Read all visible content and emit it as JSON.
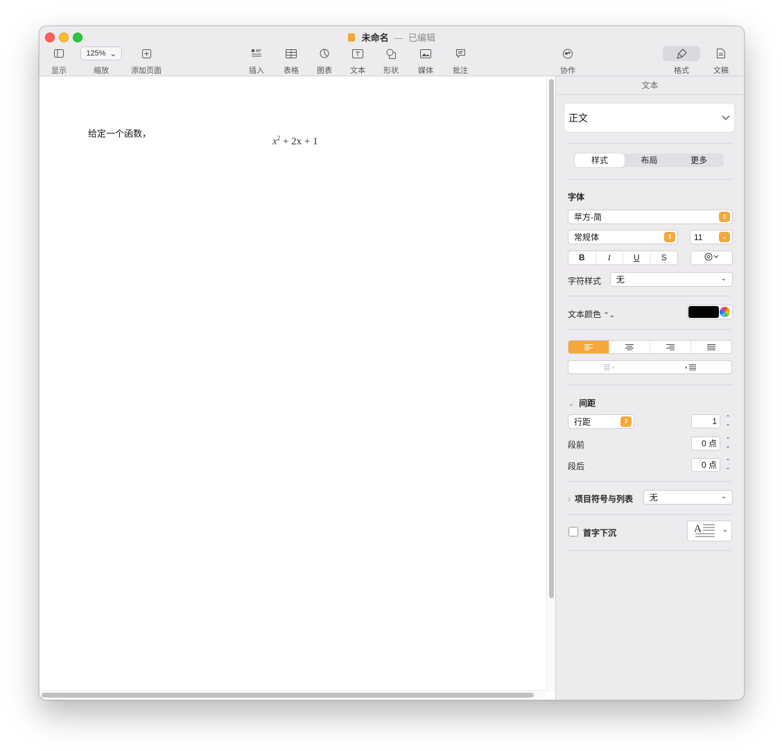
{
  "window": {
    "doc_name": "未命名",
    "separator": "—",
    "status": "已编辑"
  },
  "toolbar": {
    "view_label": "显示",
    "zoom_value": "125%",
    "zoom_label": "缩放",
    "add_page_label": "添加页面",
    "insert_label": "插入",
    "table_label": "表格",
    "chart_label": "图表",
    "text_label": "文本",
    "shape_label": "形状",
    "media_label": "媒体",
    "comment_label": "批注",
    "collaborate_label": "协作",
    "format_label": "格式",
    "document_label": "文稿"
  },
  "document": {
    "body_text": "给定一个函数，",
    "formula_base": "x",
    "formula_exp": "2",
    "formula_rest": " + 2x + 1"
  },
  "sidebar": {
    "header": "文本",
    "paragraph_style": "正文",
    "tabs": [
      "样式",
      "布局",
      "更多"
    ],
    "font_section": "字体",
    "font_family": "苹方-简",
    "font_weight": "常规体",
    "font_size": "11",
    "bold": "B",
    "italic": "I",
    "underline": "U",
    "strike": "S",
    "char_style_label": "字符样式",
    "char_style_value": "无",
    "text_color_label": "文本颜色",
    "text_color": "#000000",
    "spacing_section": "间距",
    "line_spacing_mode": "行距",
    "line_spacing_value": "1",
    "before_label": "段前",
    "before_value": "0 点",
    "after_label": "段后",
    "after_value": "0 点",
    "bullets_label": "项目符号与列表",
    "bullets_value": "无",
    "dropcap_label": "首字下沉",
    "accent_color": "#f4a73a"
  }
}
